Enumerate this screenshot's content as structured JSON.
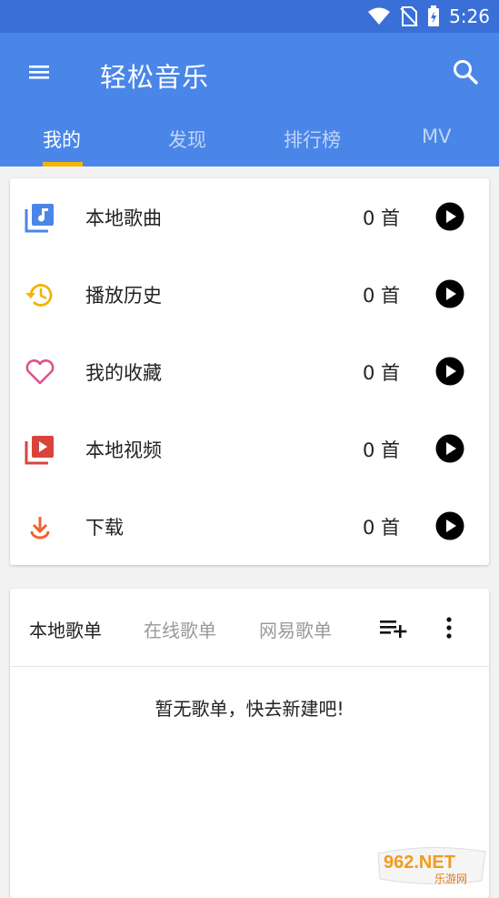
{
  "status_bar": {
    "time": "5:26"
  },
  "app_bar": {
    "title": "轻松音乐",
    "tabs": [
      {
        "label": "我的",
        "active": true
      },
      {
        "label": "发现",
        "active": false
      },
      {
        "label": "排行榜",
        "active": false
      },
      {
        "label": "MV",
        "active": false
      }
    ]
  },
  "library": {
    "items": [
      {
        "label": "本地歌曲",
        "count": "0 首",
        "icon": "local-music-icon",
        "icon_color": "#4a86e8"
      },
      {
        "label": "播放历史",
        "count": "0 首",
        "icon": "history-icon",
        "icon_color": "#f4b400"
      },
      {
        "label": "我的收藏",
        "count": "0 首",
        "icon": "heart-icon",
        "icon_color": "#e0508c"
      },
      {
        "label": "本地视频",
        "count": "0 首",
        "icon": "video-icon",
        "icon_color": "#d9443a"
      },
      {
        "label": "下载",
        "count": "0 首",
        "icon": "download-icon",
        "icon_color": "#f0652f"
      }
    ]
  },
  "playlists": {
    "tabs": [
      {
        "label": "本地歌单",
        "active": true
      },
      {
        "label": "在线歌单",
        "active": false
      },
      {
        "label": "网易歌单",
        "active": false
      }
    ],
    "empty_text": "暂无歌单，快去新建吧!"
  },
  "watermark": {
    "text_big": "962.NET",
    "text_small": "乐游网"
  },
  "colors": {
    "primary": "#4a86e8",
    "status_bar": "#3a6fd8",
    "tab_indicator": "#f4b400"
  }
}
